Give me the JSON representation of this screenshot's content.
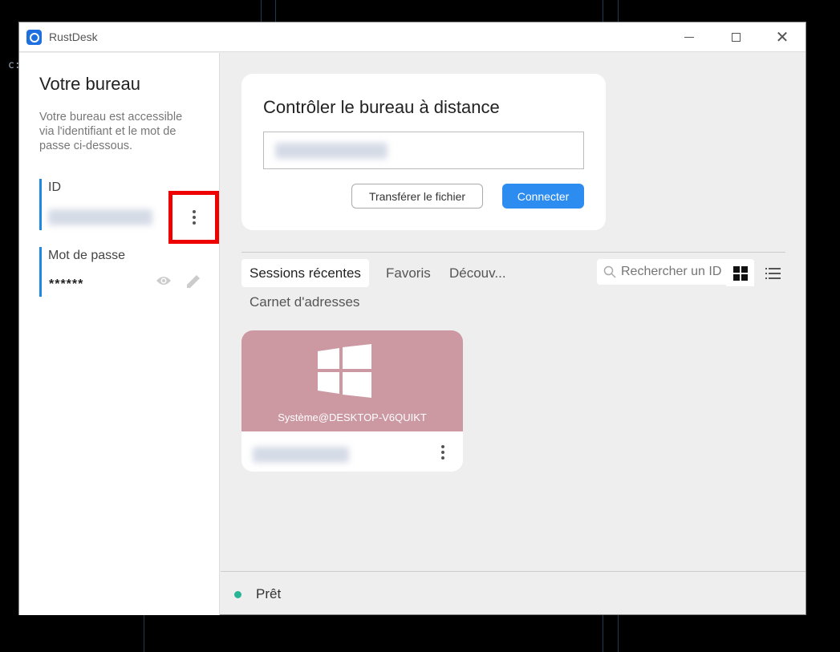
{
  "window": {
    "title": "RustDesk",
    "controls": [
      "minimize-icon",
      "maximize-icon",
      "close-icon"
    ]
  },
  "background": {
    "terminal_text": "c:"
  },
  "left_panel": {
    "title": "Votre bureau",
    "description": "Votre bureau est accessible via l'identifiant et le mot de passe ci-dessous.",
    "id_label": "ID",
    "password_label": "Mot de passe",
    "password_value": "******"
  },
  "connect_card": {
    "title": "Contrôler le bureau à distance",
    "transfer_label": "Transférer le fichier",
    "connect_label": "Connecter"
  },
  "tabs": [
    "Sessions récentes",
    "Favoris",
    "Découv...",
    "Carnet d'adresses"
  ],
  "search": {
    "placeholder": "Rechercher un ID"
  },
  "sessions": [
    {
      "host": "Système@DESKTOP-V6QUIKT",
      "os_icon": "windows-icon"
    }
  ],
  "status": {
    "text": "Prêt",
    "color": "#27b596"
  },
  "colors": {
    "accent": "#2d8cf0",
    "card_background": "#cc98a1",
    "highlight_box": "#e00000"
  }
}
